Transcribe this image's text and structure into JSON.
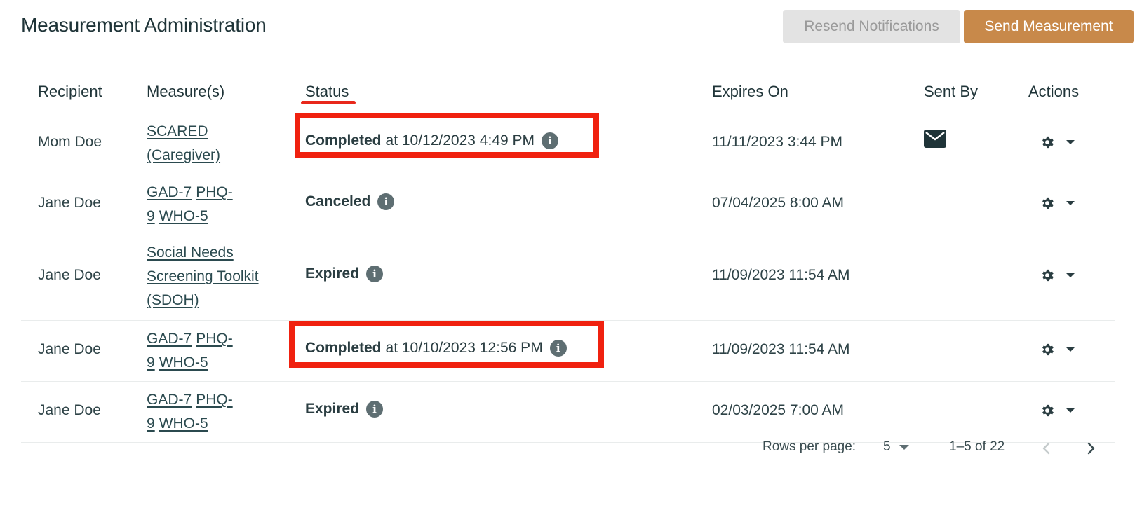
{
  "header": {
    "title": "Measurement Administration",
    "resend_label": "Resend Notifications",
    "send_label": "Send Measurement"
  },
  "table": {
    "columns": {
      "recipient": "Recipient",
      "measures": "Measure(s)",
      "status": "Status",
      "expires": "Expires On",
      "sent_by": "Sent By",
      "actions": "Actions"
    },
    "rows": [
      {
        "recipient": "Mom Doe",
        "measures": [
          "SCARED (Caregiver)"
        ],
        "status": "Completed",
        "status_detail": "at 10/12/2023 4:49 PM",
        "expires": "11/11/2023 3:44 PM",
        "sent_by_icon": "envelope-icon"
      },
      {
        "recipient": "Jane Doe",
        "measures": [
          "GAD-7",
          "PHQ-9",
          "WHO-5"
        ],
        "status": "Canceled",
        "status_detail": "",
        "expires": "07/04/2025 8:00 AM"
      },
      {
        "recipient": "Jane Doe",
        "measures": [
          "Social Needs Screening Toolkit (SDOH)"
        ],
        "status": "Expired",
        "status_detail": "",
        "expires": "11/09/2023 11:54 AM"
      },
      {
        "recipient": "Jane Doe",
        "measures": [
          "GAD-7",
          "PHQ-9",
          "WHO-5"
        ],
        "status": "Completed",
        "status_detail": "at 10/10/2023 12:56 PM",
        "expires": "11/09/2023 11:54 AM"
      },
      {
        "recipient": "Jane Doe",
        "measures": [
          "GAD-7",
          "PHQ-9",
          "WHO-5"
        ],
        "status": "Expired",
        "status_detail": "",
        "expires": "02/03/2025 7:00 AM"
      }
    ]
  },
  "pagination": {
    "rows_per_page_label": "Rows per page:",
    "rows_per_page_value": "5",
    "range": "1–5 of 22"
  },
  "colors": {
    "primary_button": "#c8894a",
    "disabled_button": "#e3e3e3",
    "highlight": "#f0210f",
    "text": "#1f3438"
  }
}
